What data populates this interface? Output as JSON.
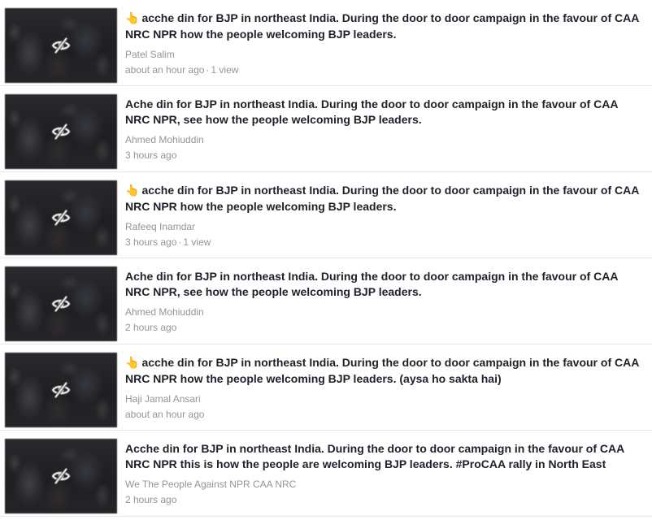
{
  "videos": [
    {
      "emoji": "👆",
      "title": "acche din for BJP in northeast India. During the door to door campaign in the favour of CAA NRC NPR how the people welcoming BJP leaders.",
      "author": "Patel Salim",
      "time": "about an hour ago",
      "views": "1 view"
    },
    {
      "emoji": "",
      "title": "Ache din for BJP in northeast India. During the door to door campaign in the favour of CAA NRC NPR, see how the people welcoming BJP leaders.",
      "author": "Ahmed Mohiuddin",
      "time": "3 hours ago",
      "views": ""
    },
    {
      "emoji": "👆",
      "title": "acche din for BJP in northeast India. During the door to door campaign in the favour of CAA NRC NPR how the people welcoming BJP leaders.",
      "author": "Rafeeq Inamdar",
      "time": "3 hours ago",
      "views": "1 view"
    },
    {
      "emoji": "",
      "title": "Ache din for BJP in northeast India. During the door to door campaign in the favour of CAA NRC NPR, see how the people welcoming BJP leaders.",
      "author": "Ahmed Mohiuddin",
      "time": "2 hours ago",
      "views": ""
    },
    {
      "emoji": "👆",
      "title": "acche din for BJP in northeast India. During the door to door campaign in the favour of CAA NRC NPR how the people welcoming BJP leaders. (aysa ho sakta hai)",
      "author": "Haji Jamal Ansari",
      "time": "about an hour ago",
      "views": ""
    },
    {
      "emoji": "",
      "title": "Acche din for BJP in northeast India. During the door to door campaign in the favour of CAA NRC NPR this is how the people are welcoming BJP leaders. #ProCAA rally in North East",
      "author": "We The People Against NPR CAA NRC",
      "time": "2 hours ago",
      "views": ""
    }
  ],
  "meta_separator": "·",
  "colors": {
    "title": "#1d2129",
    "meta": "#90949c",
    "divider": "#e5e6e9"
  }
}
